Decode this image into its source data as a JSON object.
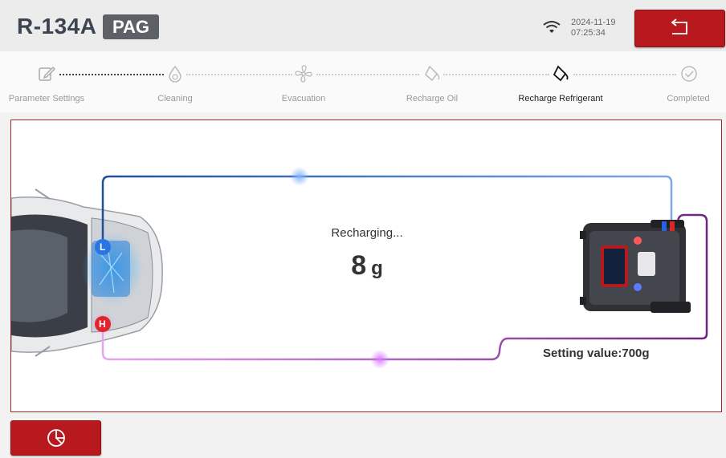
{
  "header": {
    "refrigerant": "R-134A",
    "oil_type": "PAG",
    "date": "2024-11-19",
    "time": "07:25:34",
    "icons": {
      "wifi": "wifi-icon",
      "back": "back-arrow-icon"
    }
  },
  "steps": [
    {
      "label": "Parameter Settings",
      "icon": "edit-icon",
      "state": "done"
    },
    {
      "label": "Cleaning",
      "icon": "droplet-icon",
      "state": "pending"
    },
    {
      "label": "Evacuation",
      "icon": "fan-icon",
      "state": "pending"
    },
    {
      "label": "Recharge Oil",
      "icon": "oil-can-icon",
      "state": "pending"
    },
    {
      "label": "Recharge Refrigerant",
      "icon": "refrigerant-icon",
      "state": "active"
    },
    {
      "label": "Completed",
      "icon": "check-circle-icon",
      "state": "pending"
    }
  ],
  "process": {
    "status": "Recharging...",
    "value": "8",
    "unit": "g",
    "setting_text": "Setting value:700g",
    "low_port": "L",
    "high_port": "H",
    "colors": {
      "accent": "#b8191f",
      "low_line": "#1e4fa0",
      "high_line": "#7a2a86"
    }
  },
  "footer": {
    "report_icon": "pie-chart-icon"
  }
}
